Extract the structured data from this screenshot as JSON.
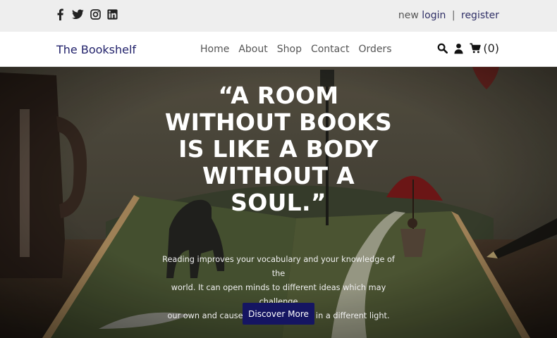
{
  "topbar": {
    "social": [
      "facebook-icon",
      "twitter-icon",
      "instagram-icon",
      "linkedin-icon"
    ],
    "auth": {
      "prefix": "new",
      "login": "login",
      "separator": "|",
      "register": "register"
    }
  },
  "navbar": {
    "brand": "The Bookshelf",
    "menu": [
      "Home",
      "About",
      "Shop",
      "Contact",
      "Orders"
    ],
    "cart_count": "(0)"
  },
  "hero": {
    "quote_lines": [
      "“A ROOM",
      "WITHOUT BOOKS",
      "IS LIKE A BODY",
      "WITHOUT A",
      "SOUL.”"
    ],
    "description_lines": [
      "Reading improves your vocabulary and your knowledge of the",
      "world. It can open minds to different ideas which may challenge",
      "our own and cause us to view things in a different light."
    ],
    "cta_label": "Discover More"
  },
  "colors": {
    "brand": "#22226b",
    "cta": "#151562",
    "topbar_bg": "#eeeeee"
  }
}
